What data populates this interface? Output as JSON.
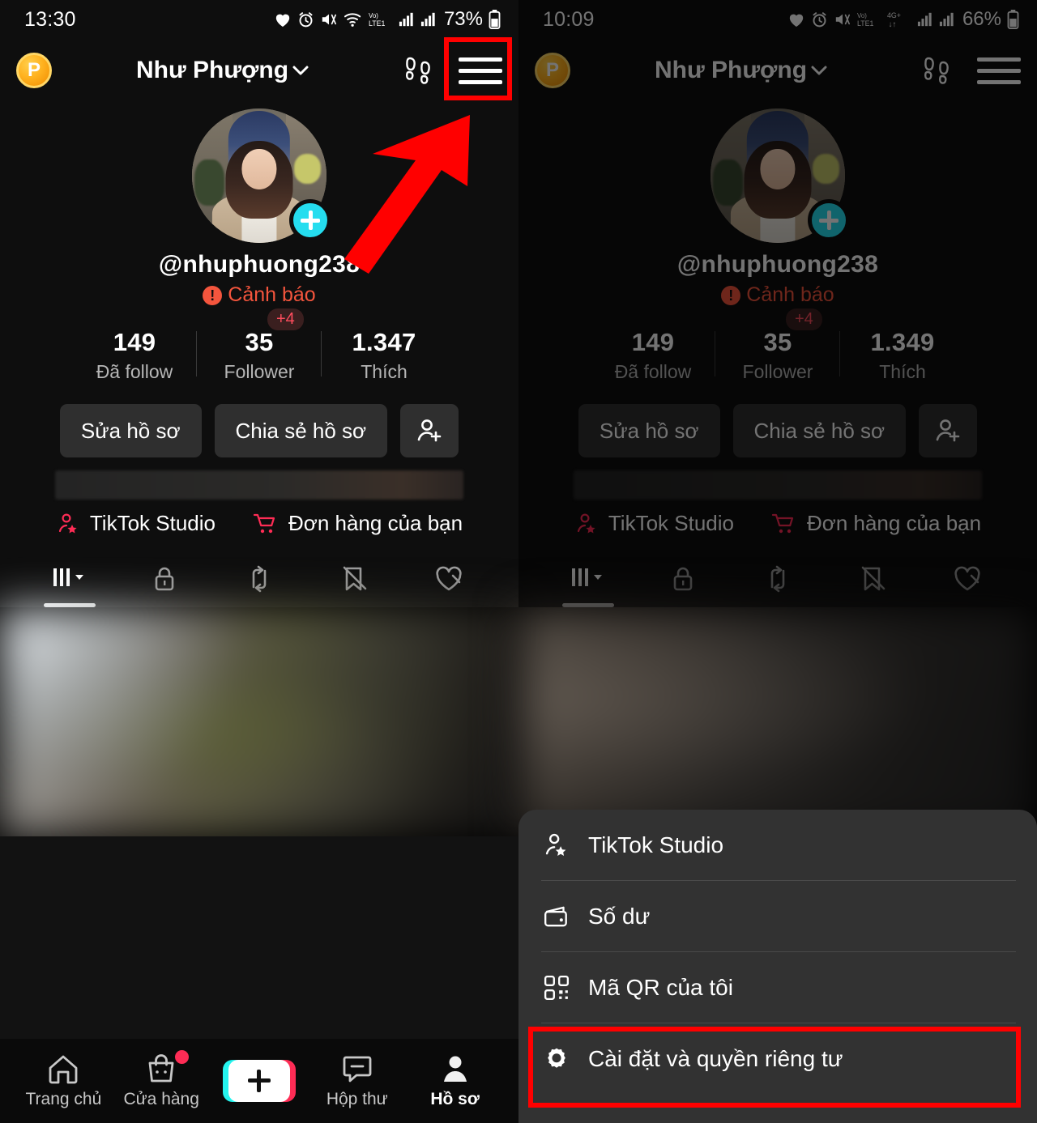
{
  "left_panel": {
    "status": {
      "time": "13:30",
      "battery": "73%",
      "network": "LTE1",
      "volte": "Vo)",
      "icons": [
        "heart-icon",
        "alarm-icon",
        "mute-icon",
        "wifi-icon",
        "volte-icon",
        "signal-icon",
        "signal-icon",
        "battery-icon"
      ]
    },
    "header": {
      "coin_letter": "P",
      "title": "Như Phượng",
      "chevron": "⌄",
      "footprints_icon": "footprints-icon",
      "menu_icon": "hamburger-icon"
    },
    "profile": {
      "handle": "@nhuphuong238",
      "warning_label": "Cảnh báo",
      "warning_mark": "!",
      "add_badge": "+"
    },
    "stats": [
      {
        "num": "149",
        "label": "Đã follow",
        "badge": ""
      },
      {
        "num": "35",
        "label": "Follower",
        "badge": "+4"
      },
      {
        "num": "1.347",
        "label": "Thích",
        "badge": ""
      }
    ],
    "actions": {
      "edit": "Sửa hồ sơ",
      "share": "Chia sẻ hồ sơ",
      "add_friend_icon": "add-person-icon"
    },
    "quicklinks": [
      {
        "label": "TikTok Studio",
        "icon": "person-star-icon"
      },
      {
        "label": "Đơn hàng của bạn",
        "icon": "cart-icon"
      }
    ],
    "tabs": [
      {
        "icon": "grid-posts-icon",
        "active": "true"
      },
      {
        "icon": "lock-icon",
        "active": "false"
      },
      {
        "icon": "repost-icon",
        "active": "false"
      },
      {
        "icon": "bookmark-off-icon",
        "active": "false"
      },
      {
        "icon": "heart-off-icon",
        "active": "false"
      }
    ]
  },
  "right_panel": {
    "status": {
      "time": "10:09",
      "battery": "66%",
      "network": "LTE1",
      "net_type": "4G+"
    },
    "header": {
      "coin_letter": "P",
      "title": "Như Phượng"
    },
    "profile": {
      "handle": "@nhuphuong238",
      "warning_label": "Cảnh báo"
    },
    "stats": [
      {
        "num": "149",
        "label": "Đã follow",
        "badge": ""
      },
      {
        "num": "35",
        "label": "Follower",
        "badge": "+4"
      },
      {
        "num": "1.349",
        "label": "Thích",
        "badge": ""
      }
    ],
    "actions": {
      "edit": "Sửa hồ sơ",
      "share": "Chia sẻ hồ sơ"
    },
    "quicklinks": [
      {
        "label": "TikTok Studio"
      },
      {
        "label": "Đơn hàng của bạn"
      }
    ]
  },
  "sheet_menu": {
    "items": [
      {
        "label": "TikTok Studio",
        "icon": "person-star-icon",
        "highlighted": "false"
      },
      {
        "label": "Số dư",
        "icon": "wallet-icon",
        "highlighted": "false"
      },
      {
        "label": "Mã QR của tôi",
        "icon": "qr-code-icon",
        "highlighted": "false"
      },
      {
        "label": "Cài đặt và quyền riêng tư",
        "icon": "gear-icon",
        "highlighted": "true"
      }
    ]
  },
  "bottom_nav": [
    {
      "label": "Trang chủ",
      "icon": "home-icon",
      "badge": "false",
      "active": "false"
    },
    {
      "label": "Cửa hàng",
      "icon": "shop-bag-icon",
      "badge": "true",
      "active": "false"
    },
    {
      "label": "",
      "icon": "create-plus-icon",
      "badge": "false",
      "active": "false"
    },
    {
      "label": "Hộp thư",
      "icon": "inbox-icon",
      "badge": "false",
      "active": "false"
    },
    {
      "label": "Hồ sơ",
      "icon": "profile-person-icon",
      "badge": "false",
      "active": "true"
    }
  ],
  "annotations": {
    "arrow_color": "#ff0000",
    "highlight_color": "#ff0000",
    "hamburger_highlight": "hamburger-menu-highlight",
    "settings_highlight": "settings-item-highlight"
  },
  "colors": {
    "accent_pink": "#fe2c55",
    "accent_cyan": "#25f4ee",
    "warning_red": "#f4553d",
    "coin_gold": "#ffb21f",
    "sheet_bg": "#323232",
    "annotation_red": "#ff0000"
  }
}
